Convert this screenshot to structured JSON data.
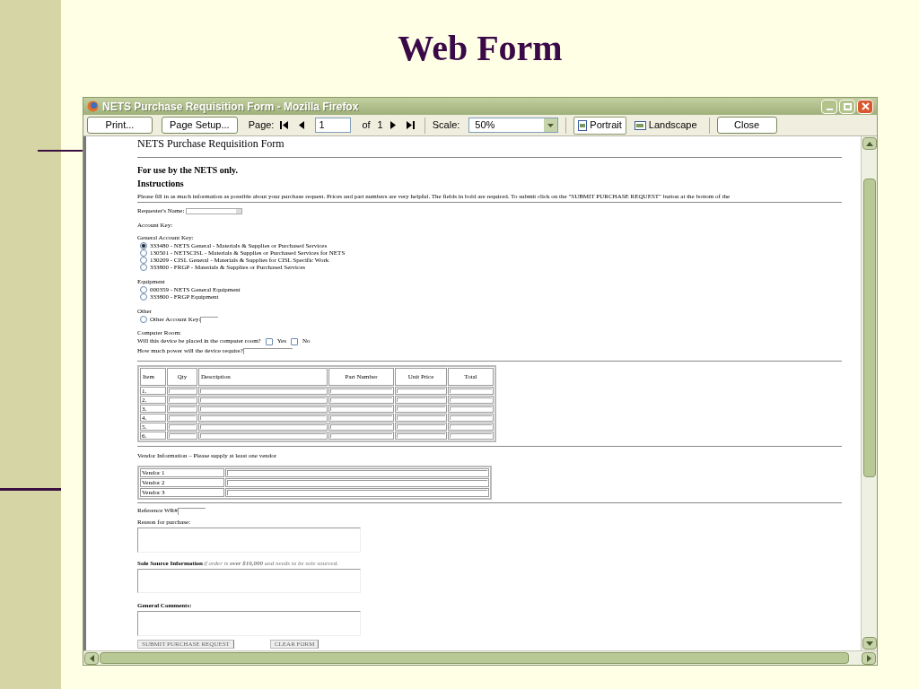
{
  "slide_title": "Web Form",
  "window": {
    "title": "NETS Purchase Requisition Form - Mozilla Firefox",
    "toolbar": {
      "print": "Print...",
      "page_setup": "Page Setup...",
      "page_label": "Page:",
      "page_value": "1",
      "of_label": "of",
      "page_total": "1",
      "scale_label": "Scale:",
      "scale_value": "50%",
      "orientation": [
        {
          "label": "Portrait",
          "selected": true
        },
        {
          "label": "Landscape",
          "selected": false
        }
      ],
      "close": "Close"
    }
  },
  "form": {
    "heading": "NETS Purchase Requisition Form",
    "subheading": "For use by the NETS only.",
    "instructions_heading": "Instructions",
    "instructions": "Please fill in as much information as possible about your purchase request. Prices and part numbers are very helpful. The fields in bold are required. To submit click on the \"SUBMIT PURCHASE REQUEST\" button at the bottom of the",
    "requester_label": "Requester's Name:",
    "account_key_label": "Account Key:",
    "general_account_keys": {
      "label": "General Account Key:",
      "options": [
        {
          "label": "333480 - NETS General - Materials & Supplies or Purchased Services",
          "selected": true
        },
        {
          "label": "130501 - NETSCISL - Materials & Supplies or Purchased Services for NETS",
          "selected": false
        },
        {
          "label": "130209 - CISL General - Materials & Supplies for CISL Specific Work",
          "selected": false
        },
        {
          "label": "333800 - FRGP - Materials & Supplies or Purchased Services",
          "selected": false
        }
      ]
    },
    "equipment": {
      "label": "Equipment",
      "options": [
        {
          "label": "000359 - NETS General Equipment",
          "selected": false
        },
        {
          "label": "333800 - FRGP Equipment",
          "selected": false
        }
      ]
    },
    "other": {
      "label": "Other",
      "options": [
        {
          "label": "Other Account Key:",
          "selected": false
        }
      ]
    },
    "computer_room": {
      "label": "Computer Room:",
      "question": "Will this device be placed in the computer room?",
      "options": [
        {
          "label": "Yes",
          "selected": false
        },
        {
          "label": "No",
          "selected": false
        }
      ],
      "power_question": "How much power will the device require?"
    },
    "items_table": {
      "columns": [
        "Item",
        "Qty",
        "Description",
        "Part Number",
        "Unit Price",
        "Total"
      ],
      "rows": [
        "1.",
        "2.",
        "3.",
        "4.",
        "5.",
        "6."
      ]
    },
    "vendor_heading": "Vendor Information – Please supply at least one vendor",
    "vendors": [
      "Vendor 1",
      "Vendor 2",
      "Vendor 3"
    ],
    "reference_label": "Reference WR#",
    "reason_label": "Reason for purchase:",
    "sole_source_label": "Sole Source Information",
    "sole_source_note": "if order is **over $10,000** and needs to be sole sourced.",
    "comments_label": "General Comments:",
    "buttons": [
      "SUBMIT PURCHASE REQUEST",
      "CLEAR FORM"
    ]
  }
}
